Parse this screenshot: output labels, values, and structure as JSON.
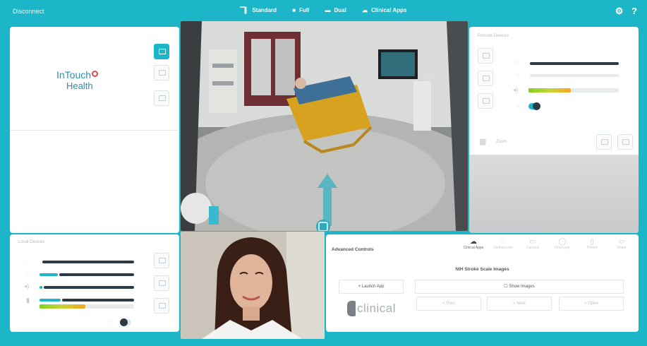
{
  "topbar": {
    "disconnect": "Disconnect",
    "modes": [
      {
        "label": "Standard",
        "icon": "standard-view-icon",
        "glyph": "▔▌"
      },
      {
        "label": "Full",
        "icon": "full-view-icon",
        "glyph": "■"
      },
      {
        "label": "Dual",
        "icon": "dual-view-icon",
        "glyph": "▬"
      },
      {
        "label": "Clinical Apps",
        "icon": "clinical-apps-icon",
        "glyph": "☁"
      }
    ],
    "settings_glyph": "⚙",
    "help_glyph": "?"
  },
  "logo": {
    "line1": "InTouch",
    "line2": "Health"
  },
  "left_bottom": {
    "label": "Local Devices"
  },
  "right_top": {
    "label": "Remote Devices"
  },
  "right_cam": {
    "label": "Zoom"
  },
  "advanced": {
    "title": "Advanced Controls",
    "tabs": [
      {
        "label": "Clinical Apps",
        "glyph": "☁"
      },
      {
        "label": "Stethoscope",
        "glyph": "◌"
      },
      {
        "label": "Camera",
        "glyph": "▭"
      },
      {
        "label": "Otoscope",
        "glyph": "◯"
      },
      {
        "label": "Printer",
        "glyph": "▯"
      },
      {
        "label": "Share",
        "glyph": "▱"
      }
    ],
    "section_title": "NIH Stroke Scale Images",
    "launch_app": "+ Launch App",
    "show_images": "☐ Show Images",
    "prev": "< Prev",
    "next": "> Next",
    "open": "+ Open",
    "clinical_logo": "clinical"
  },
  "colors": {
    "accent": "#1cb6c8",
    "dark": "#2c3a45",
    "orange": "#f5a623",
    "green": "#7ed321",
    "red": "#e2464d"
  }
}
